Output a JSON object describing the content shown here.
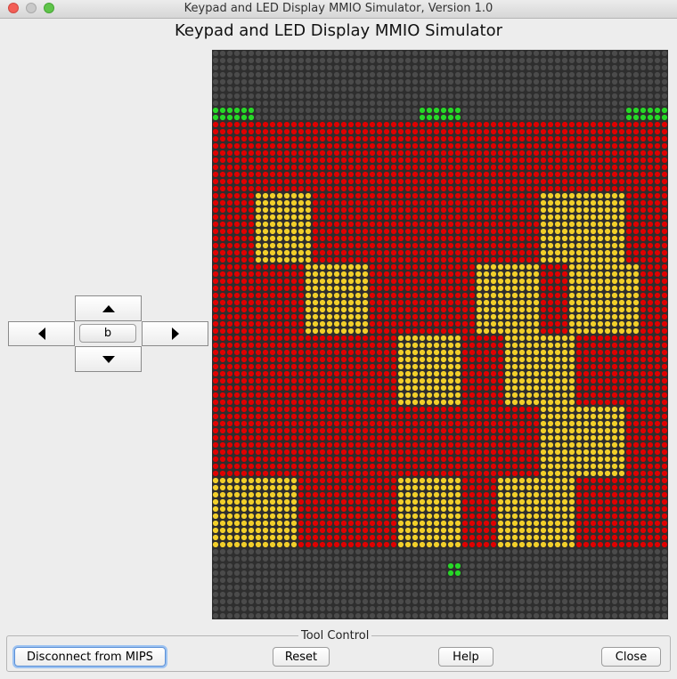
{
  "window": {
    "title": "Keypad and LED Display MMIO Simulator, Version 1.0"
  },
  "heading": "Keypad and LED Display MMIO Simulator",
  "keypad": {
    "up_icon": "arrow-up-icon",
    "down_icon": "arrow-down-icon",
    "left_icon": "arrow-left-icon",
    "right_icon": "arrow-right-icon",
    "center_label": "b"
  },
  "led_display": {
    "columns": 64,
    "rows": 80,
    "colors": {
      "off": "#4b4b4b",
      "red": "#e00000",
      "yellow": "#f2cf2a",
      "green": "#27d827"
    },
    "red_field_rows": [
      10,
      69
    ],
    "green_blocks": [
      {
        "rows": [
          8,
          9
        ],
        "cols": [
          0,
          5
        ]
      },
      {
        "rows": [
          8,
          9
        ],
        "cols": [
          29,
          34
        ]
      },
      {
        "rows": [
          8,
          9
        ],
        "cols": [
          58,
          63
        ]
      },
      {
        "rows": [
          72,
          73
        ],
        "cols": [
          33,
          34
        ]
      }
    ],
    "yellow_blocks": [
      {
        "rows": [
          20,
          29
        ],
        "cols": [
          6,
          13
        ]
      },
      {
        "rows": [
          20,
          29
        ],
        "cols": [
          46,
          57
        ]
      },
      {
        "rows": [
          30,
          39
        ],
        "cols": [
          13,
          21
        ]
      },
      {
        "rows": [
          30,
          39
        ],
        "cols": [
          37,
          45
        ]
      },
      {
        "rows": [
          30,
          39
        ],
        "cols": [
          50,
          59
        ]
      },
      {
        "rows": [
          40,
          49
        ],
        "cols": [
          26,
          34
        ]
      },
      {
        "rows": [
          40,
          49
        ],
        "cols": [
          41,
          50
        ]
      },
      {
        "rows": [
          50,
          59
        ],
        "cols": [
          46,
          57
        ]
      },
      {
        "rows": [
          60,
          69
        ],
        "cols": [
          0,
          11
        ]
      },
      {
        "rows": [
          60,
          69
        ],
        "cols": [
          26,
          34
        ]
      },
      {
        "rows": [
          60,
          69
        ],
        "cols": [
          40,
          50
        ]
      }
    ]
  },
  "tool_control": {
    "legend": "Tool Control",
    "connect_button": "Disconnect from MIPS",
    "reset_button": "Reset",
    "help_button": "Help",
    "close_button": "Close"
  }
}
